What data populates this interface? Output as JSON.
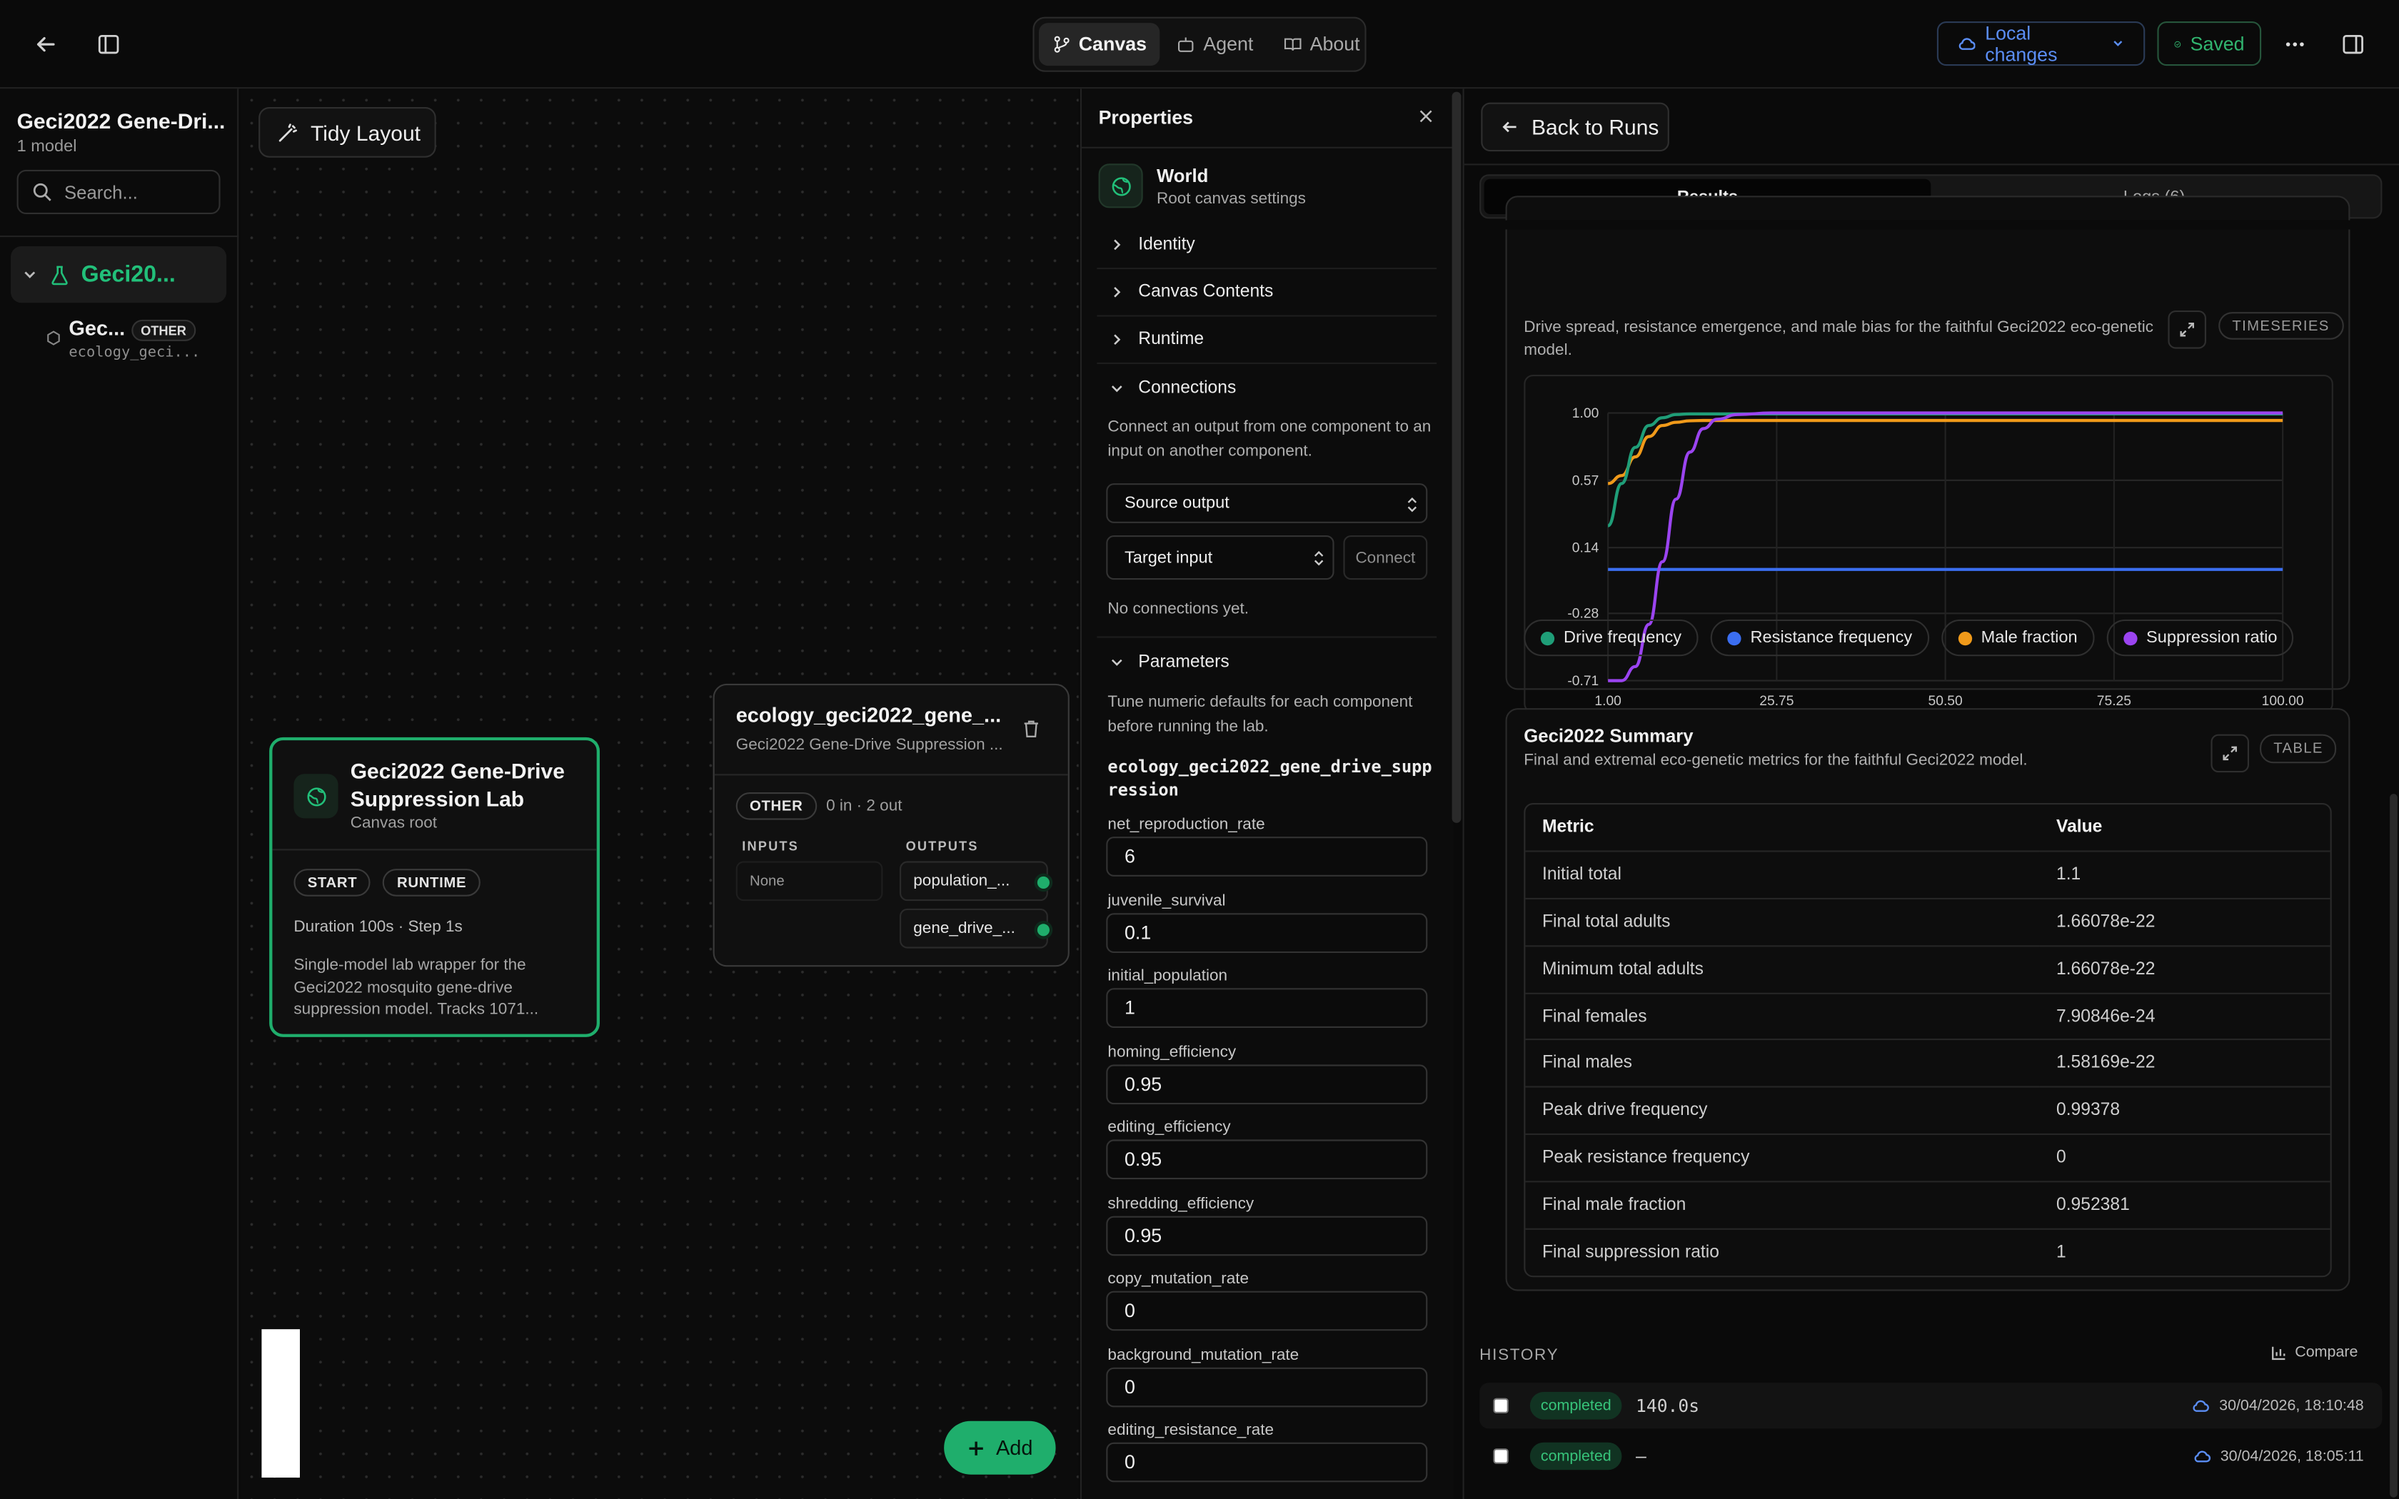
{
  "topbar": {
    "tabs": [
      {
        "label": "Canvas",
        "icon": "git-branch-icon",
        "active": true
      },
      {
        "label": "Agent",
        "icon": "bot-icon",
        "active": false
      },
      {
        "label": "About",
        "icon": "book-icon",
        "active": false
      }
    ],
    "local_changes": "Local changes",
    "saved": "Saved"
  },
  "sidebar": {
    "title": "Geci2022 Gene-Dri...",
    "subtitle": "1 model",
    "search_placeholder": "Search...",
    "tree": {
      "root_label": "Geci20...",
      "child_label": "Gec...",
      "child_tag": "OTHER",
      "child_sub": "ecology_geci..."
    }
  },
  "canvas": {
    "tidy_layout": "Tidy Layout",
    "root_node": {
      "title": "Geci2022 Gene-Drive Suppression Lab",
      "subtitle": "Canvas root",
      "tags": [
        "START",
        "RUNTIME"
      ],
      "duration": "Duration 100s · Step 1s",
      "description": "Single-model lab wrapper for the Geci2022 mosquito gene-drive suppression model. Tracks 1071..."
    },
    "model_node": {
      "title": "ecology_geci2022_gene_...",
      "subtitle": "Geci2022 Gene-Drive Suppression ...",
      "tag": "OTHER",
      "io": "0 in · 2 out",
      "inputs_label": "INPUTS",
      "outputs_label": "OUTPUTS",
      "inputs_none": "None",
      "outputs": [
        "population_...",
        "gene_drive_..."
      ]
    },
    "add_button": "Add"
  },
  "properties": {
    "title": "Properties",
    "world_title": "World",
    "world_sub": "Root canvas settings",
    "sections": [
      "Identity",
      "Canvas Contents",
      "Runtime"
    ],
    "connections": {
      "label": "Connections",
      "help": "Connect an output from one component to an input on another component.",
      "source": "Source output",
      "target": "Target input",
      "connect": "Connect",
      "empty": "No connections yet."
    },
    "parameters": {
      "label": "Parameters",
      "help": "Tune numeric defaults for each component before running the lab.",
      "model_id": "ecology_geci2022_gene_drive_suppression",
      "items": [
        {
          "name": "net_reproduction_rate",
          "value": "6"
        },
        {
          "name": "juvenile_survival",
          "value": "0.1"
        },
        {
          "name": "initial_population",
          "value": "1"
        },
        {
          "name": "homing_efficiency",
          "value": "0.95"
        },
        {
          "name": "editing_efficiency",
          "value": "0.95"
        },
        {
          "name": "shredding_efficiency",
          "value": "0.95"
        },
        {
          "name": "copy_mutation_rate",
          "value": "0"
        },
        {
          "name": "background_mutation_rate",
          "value": "0"
        },
        {
          "name": "editing_resistance_rate",
          "value": "0"
        }
      ]
    }
  },
  "results": {
    "back": "Back to Runs",
    "tabs": [
      "Results",
      "Logs (6)"
    ],
    "timeseries": {
      "description": "Drive spread, resistance emergence, and male bias for the faithful Geci2022 eco-genetic model.",
      "badge": "TIMESERIES"
    },
    "summary": {
      "title": "Geci2022 Summary",
      "description": "Final and extremal eco-genetic metrics for the faithful Geci2022 model.",
      "badge": "TABLE",
      "headers": [
        "Metric",
        "Value"
      ],
      "rows": [
        [
          "Initial total",
          "1.1"
        ],
        [
          "Final total adults",
          "1.66078e-22"
        ],
        [
          "Minimum total adults",
          "1.66078e-22"
        ],
        [
          "Final females",
          "7.90846e-24"
        ],
        [
          "Final males",
          "1.58169e-22"
        ],
        [
          "Peak drive frequency",
          "0.99378"
        ],
        [
          "Peak resistance frequency",
          "0"
        ],
        [
          "Final male fraction",
          "0.952381"
        ],
        [
          "Final suppression ratio",
          "1"
        ]
      ]
    },
    "history": {
      "label": "HISTORY",
      "compare": "Compare",
      "runs": [
        {
          "status": "completed",
          "duration": "140.0s",
          "time": "30/04/2026, 18:10:48"
        },
        {
          "status": "completed",
          "duration": "–",
          "time": "30/04/2026, 18:05:11"
        }
      ]
    }
  },
  "colors": {
    "accent_green": "#22c07a",
    "drive": "#1f9e78",
    "resistance": "#3b6ef0",
    "male": "#f09a1a",
    "suppression": "#9b44f0",
    "link_blue": "#5b8ef5"
  },
  "chart_data": {
    "type": "line",
    "x_ticks": [
      "1.00",
      "25.75",
      "50.50",
      "75.25",
      "100.00"
    ],
    "y_ticks": [
      "1.00",
      "0.57",
      "0.14",
      "-0.28",
      "-0.71"
    ],
    "xlim": [
      1,
      100
    ],
    "ylim": [
      -0.71,
      1.0
    ],
    "grid": true,
    "legend_position": "bottom",
    "x": [
      1,
      3,
      5,
      7,
      9,
      11,
      13,
      15,
      17,
      20,
      25,
      30,
      40,
      50,
      60,
      70,
      80,
      90,
      100
    ],
    "series": [
      {
        "name": "Drive frequency",
        "color": "#1f9e78",
        "values": [
          0.28,
          0.55,
          0.78,
          0.92,
          0.97,
          0.99,
          0.994,
          0.994,
          0.994,
          0.994,
          0.994,
          0.994,
          0.994,
          0.994,
          0.994,
          0.994,
          0.994,
          0.994,
          0.994
        ]
      },
      {
        "name": "Resistance frequency",
        "color": "#3b6ef0",
        "values": [
          0,
          0,
          0,
          0,
          0,
          0,
          0,
          0,
          0,
          0,
          0,
          0,
          0,
          0,
          0,
          0,
          0,
          0,
          0
        ]
      },
      {
        "name": "Male fraction",
        "color": "#f09a1a",
        "values": [
          0.55,
          0.6,
          0.72,
          0.85,
          0.92,
          0.94,
          0.95,
          0.952,
          0.952,
          0.952,
          0.952,
          0.952,
          0.952,
          0.952,
          0.952,
          0.952,
          0.952,
          0.952,
          0.952
        ]
      },
      {
        "name": "Suppression ratio",
        "color": "#9b44f0",
        "values": [
          -0.71,
          -0.71,
          -0.62,
          -0.35,
          0.05,
          0.45,
          0.75,
          0.9,
          0.96,
          0.99,
          1.0,
          1.0,
          1.0,
          1.0,
          1.0,
          1.0,
          1.0,
          1.0,
          1.0
        ]
      }
    ]
  }
}
